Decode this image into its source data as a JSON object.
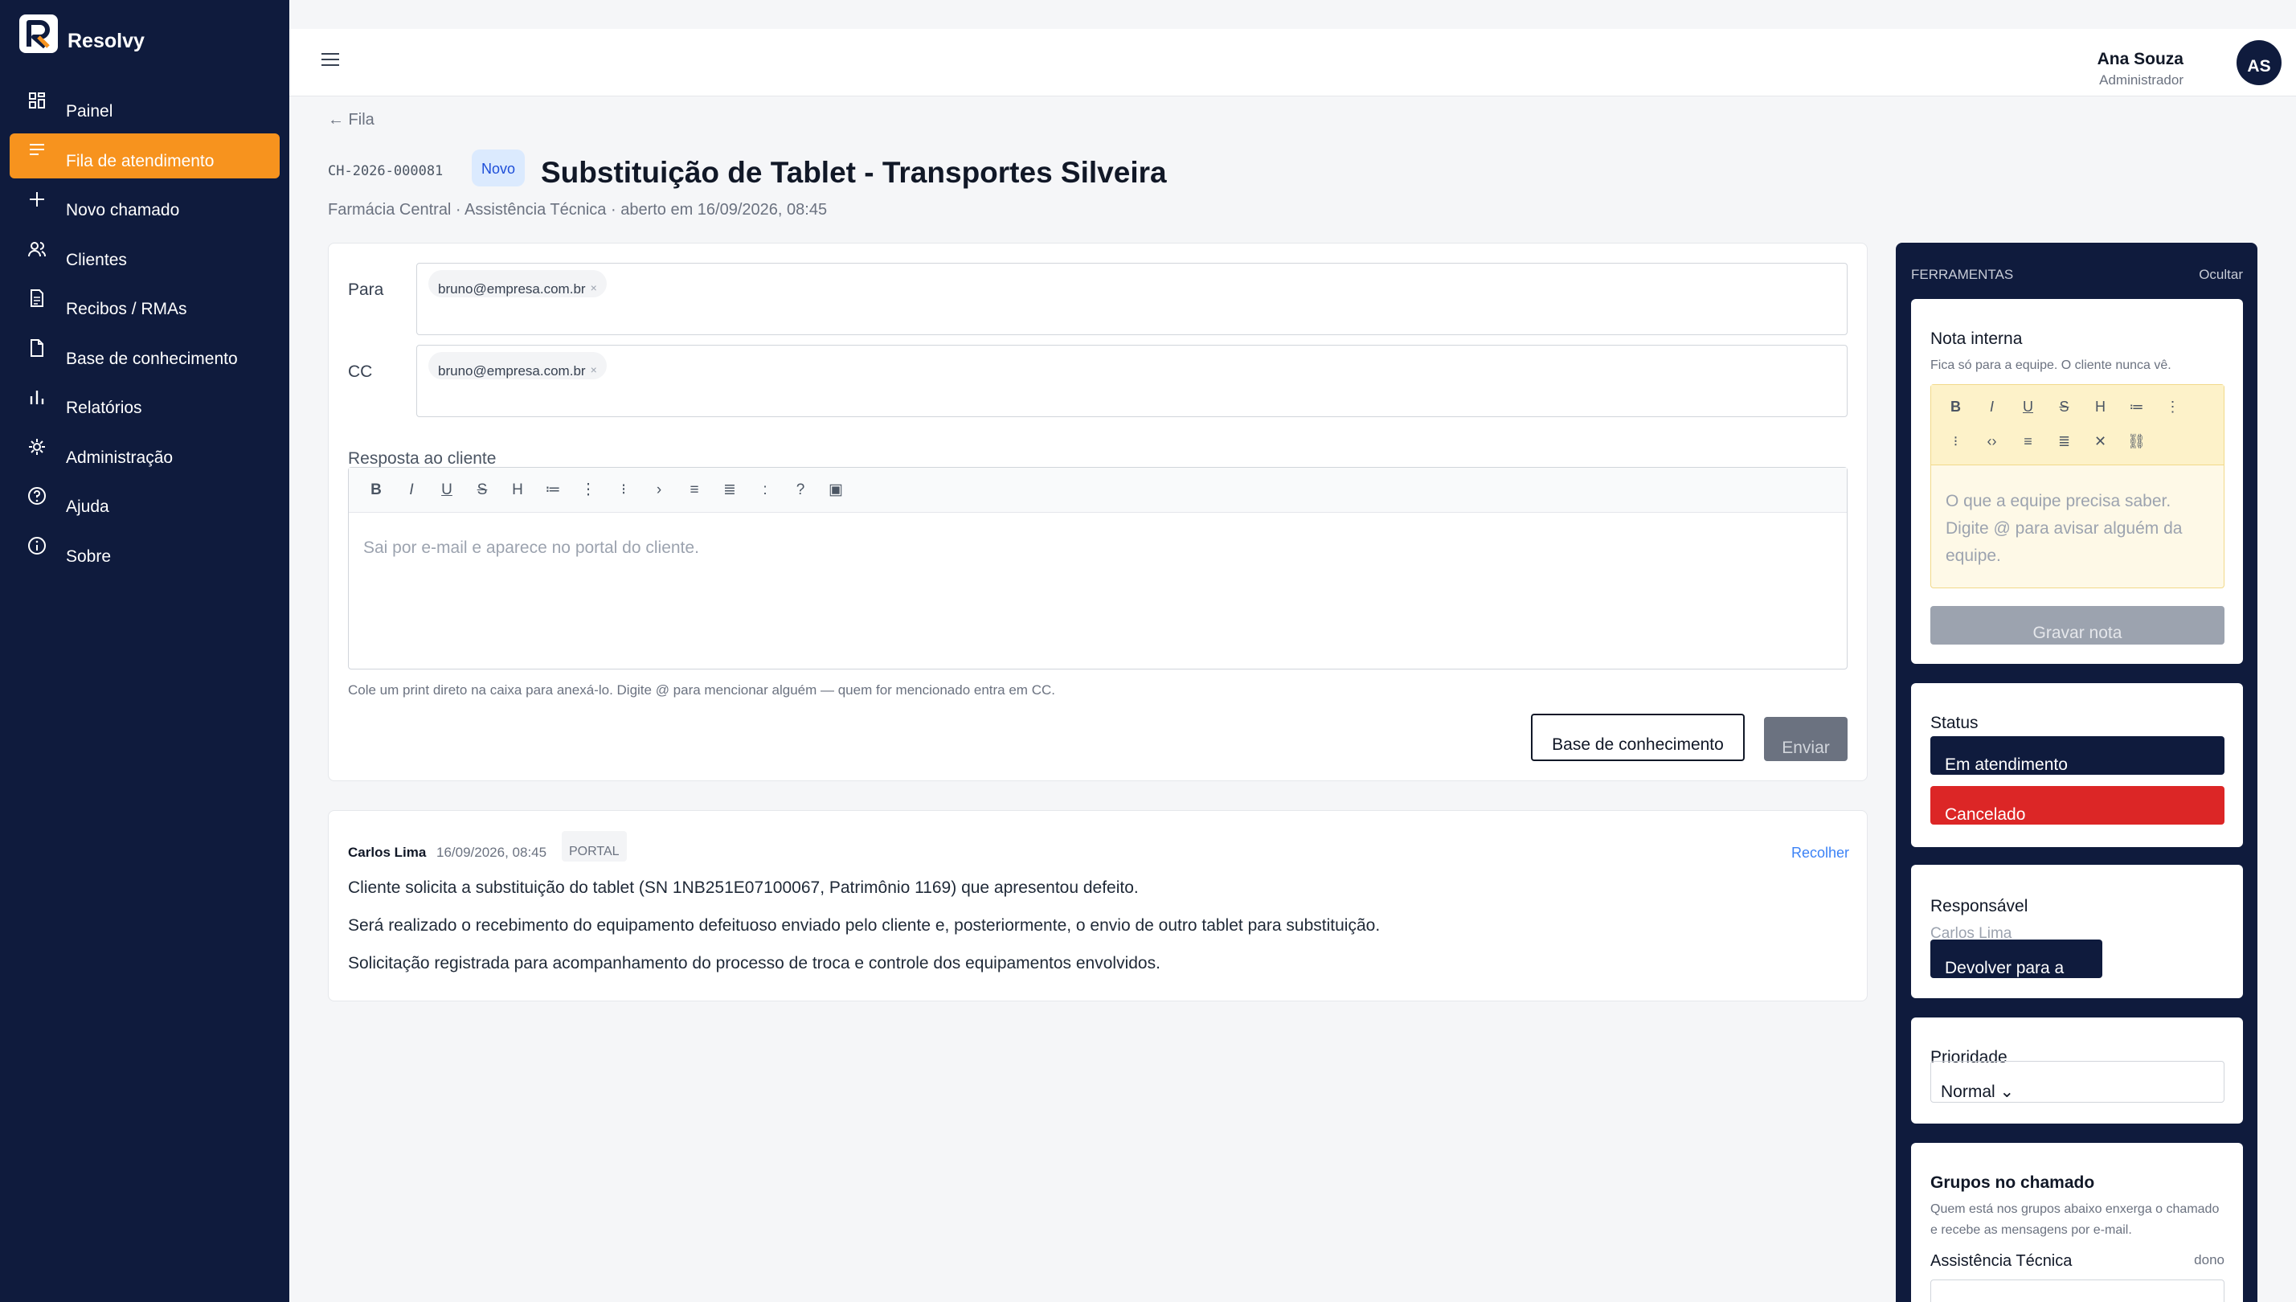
{
  "app": {
    "name": "Resolvy"
  },
  "sidebar": {
    "items": [
      {
        "label": "Painel",
        "icon": "dashboard-icon"
      },
      {
        "label": "Fila de atendimento",
        "icon": "list-icon",
        "active": true
      },
      {
        "label": "Novo chamado",
        "icon": "plus-icon"
      },
      {
        "label": "Clientes",
        "icon": "users-icon"
      },
      {
        "label": "Recibos / RMAs",
        "icon": "receipt-icon"
      },
      {
        "label": "Base de conhecimento",
        "icon": "document-icon"
      },
      {
        "label": "Relatórios",
        "icon": "bar-chart-icon"
      },
      {
        "label": "Administração",
        "icon": "gear-icon"
      },
      {
        "label": "Ajuda",
        "icon": "help-icon"
      },
      {
        "label": "Sobre",
        "icon": "info-icon"
      }
    ]
  },
  "header": {
    "user_name": "Ana Souza",
    "user_role": "Administrador",
    "avatar_initials": "AS"
  },
  "ticket": {
    "back_label": "← Fila",
    "id": "CH-2026-000081",
    "badge": "Novo",
    "title": "Substituição de Tablet - Transportes Silveira",
    "meta": "Farmácia Central · Assistência Técnica · aberto em 16/09/2026, 08:45"
  },
  "compose": {
    "to_label": "Para",
    "to_email": "bruno@empresa.com.br",
    "cc_label": "CC",
    "cc_email": "bruno@empresa.com.br",
    "remove_glyph": "×",
    "response_label": "Resposta ao cliente",
    "toolbar": [
      "B",
      "I",
      "U",
      "S",
      "H",
      "≔",
      "⋮",
      "⁝",
      "›",
      "≡",
      "≣",
      ":",
      "?",
      "▣"
    ],
    "placeholder": "Sai por e-mail e aparece no portal do cliente.",
    "hint": "Cole um print direto na caixa para anexá-lo. Digite @ para mencionar alguém — quem for mencionado entra em CC.",
    "kb_button": "Base de conhecimento",
    "send_button": "Enviar"
  },
  "message": {
    "author": "Carlos Lima",
    "date": "16/09/2026, 08:45",
    "tag": "PORTAL",
    "collapse": "Recolher",
    "lines": [
      "Cliente solicita a substituição do tablet (SN 1NB251E07100067, Patrimônio 1169) que apresentou defeito.",
      "Será realizado o recebimento do equipamento defeituoso enviado pelo cliente e, posteriormente, o envio de outro tablet para substituição.",
      "Solicitação registrada para acompanhamento do processo de troca e controle dos equipamentos envolvidos."
    ]
  },
  "tools": {
    "title": "FERRAMENTAS",
    "hide": "Ocultar",
    "note": {
      "title": "Nota interna",
      "subtitle": "Fica só para a equipe. O cliente nunca vê.",
      "toolbar": [
        "B",
        "I",
        "U",
        "S",
        "H",
        "≔",
        "⋮",
        "⁝",
        "‹›",
        "≡",
        "≣",
        "✕",
        "⛓"
      ],
      "placeholder": "O que a equipe precisa saber. Digite @ para avisar alguém da equipe.",
      "button": "Gravar nota"
    },
    "status": {
      "title": "Status",
      "current": "Em atendimento",
      "cancel": "Cancelado"
    },
    "responsible": {
      "title": "Responsável",
      "name": "Carlos Lima",
      "button": "Devolver para a fila"
    },
    "priority": {
      "title": "Prioridade",
      "value": "Normal ⌄"
    },
    "groups": {
      "title": "Grupos no chamado",
      "subtitle": "Quem está nos grupos abaixo enxerga o chamado e recebe as mensagens por e-mail.",
      "group_name": "Assistência Técnica",
      "group_role": "dono"
    }
  },
  "colors": {
    "sidebar_bg": "#0f1b3d",
    "accent": "#f7931e",
    "danger": "#dc2626"
  }
}
